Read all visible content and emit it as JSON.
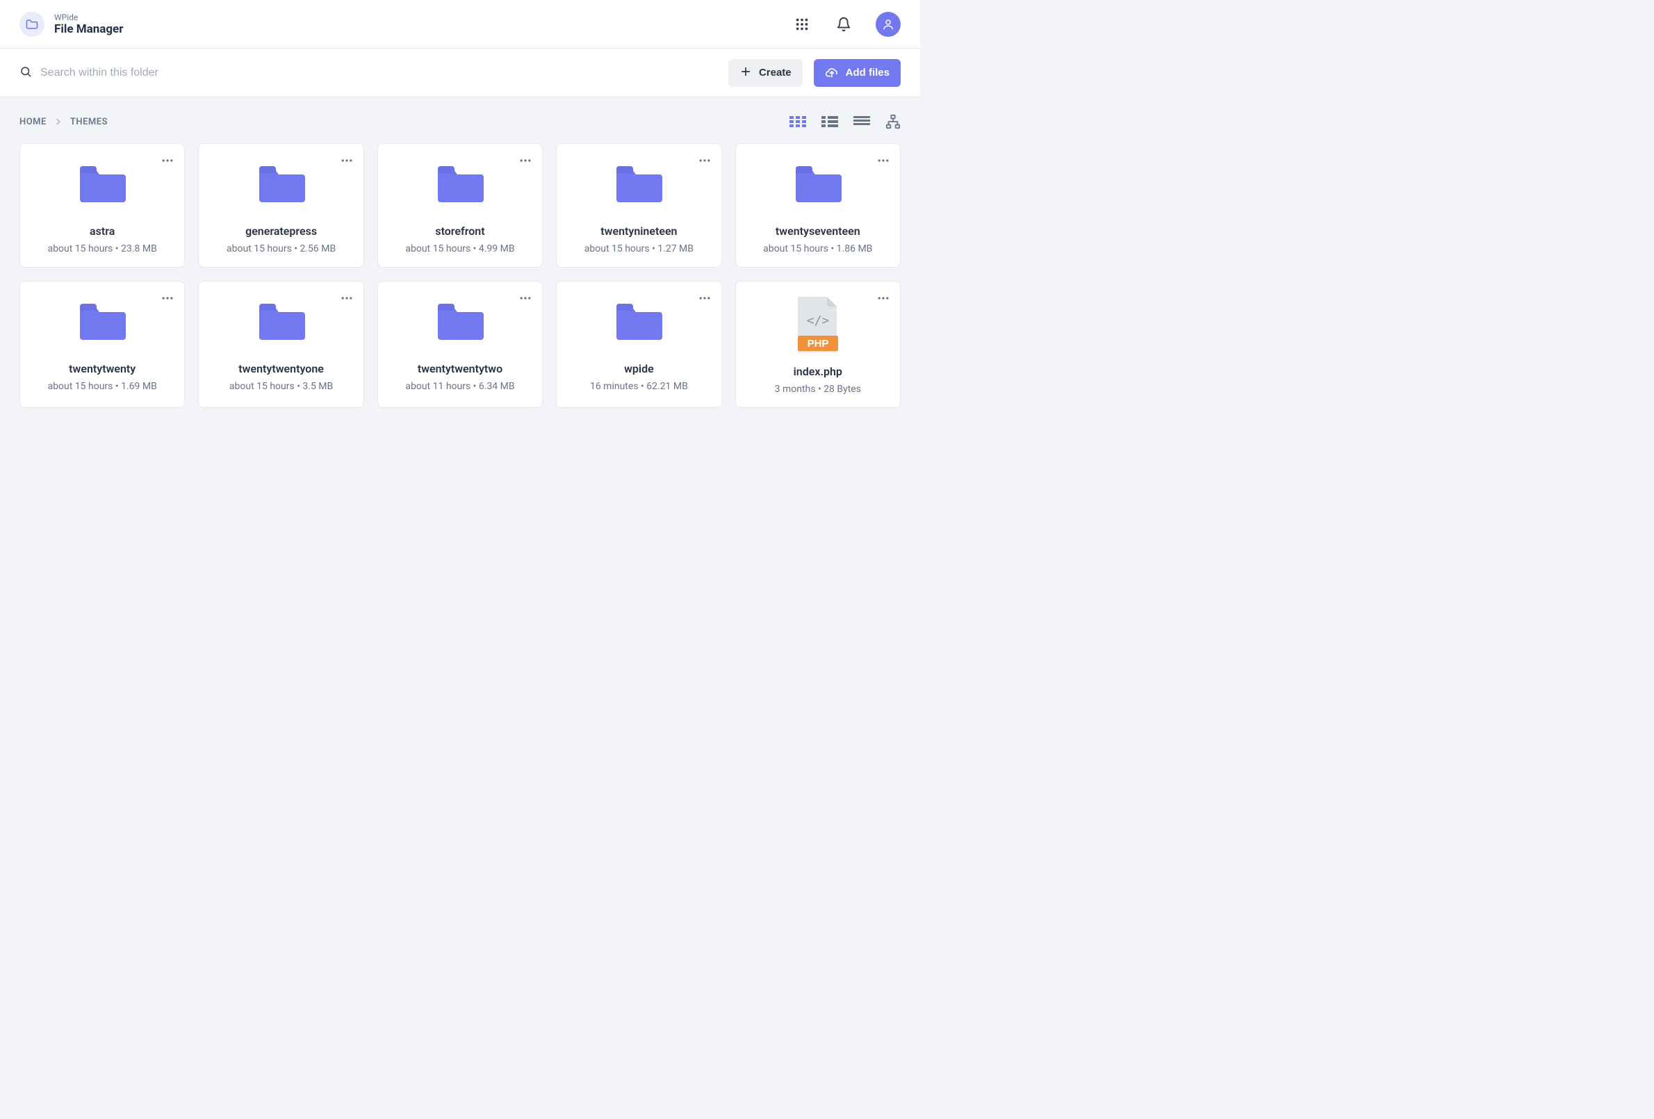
{
  "brand": {
    "eyebrow": "WPide",
    "title": "File Manager"
  },
  "search": {
    "placeholder": "Search within this folder"
  },
  "buttons": {
    "create": "Create",
    "addFiles": "Add files"
  },
  "breadcrumb": {
    "home": "HOME",
    "current": "THEMES"
  },
  "items": [
    {
      "name": "astra",
      "time": "about 15 hours",
      "size": "23.8 MB",
      "type": "folder"
    },
    {
      "name": "generatepress",
      "time": "about 15 hours",
      "size": "2.56 MB",
      "type": "folder"
    },
    {
      "name": "storefront",
      "time": "about 15 hours",
      "size": "4.99 MB",
      "type": "folder"
    },
    {
      "name": "twentynineteen",
      "time": "about 15 hours",
      "size": "1.27 MB",
      "type": "folder"
    },
    {
      "name": "twentyseventeen",
      "time": "about 15 hours",
      "size": "1.86 MB",
      "type": "folder"
    },
    {
      "name": "twentytwenty",
      "time": "about 15 hours",
      "size": "1.69 MB",
      "type": "folder"
    },
    {
      "name": "twentytwentyone",
      "time": "about 15 hours",
      "size": "3.5 MB",
      "type": "folder"
    },
    {
      "name": "twentytwentytwo",
      "time": "about 11 hours",
      "size": "6.34 MB",
      "type": "folder"
    },
    {
      "name": "wpide",
      "time": "16 minutes",
      "size": "62.21 MB",
      "type": "folder"
    },
    {
      "name": "index.php",
      "time": "3 months",
      "size": "28 Bytes",
      "type": "php"
    }
  ],
  "phpBadge": "PHP"
}
